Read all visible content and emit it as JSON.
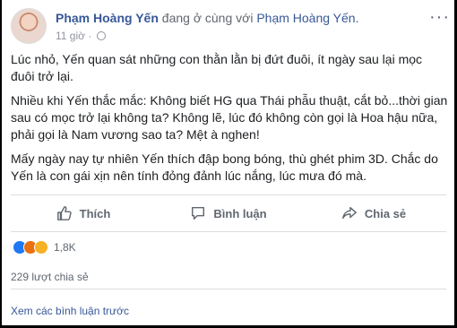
{
  "post": {
    "author": "Phạm Hoàng Yến",
    "with_text": "đang ở cùng với",
    "tagged": "Phạm Hoàng Yến.",
    "time": "11 giờ ·",
    "more": "···",
    "paragraphs": [
      "Lúc nhỏ, Yến quan sát những con thằn lằn bị đứt đuôi, ít ngày sau lại mọc đuôi trở lại.",
      "Nhiều khi Yến thắc mắc: Không biết HG qua Thái phẫu thuật, cắt bỏ...thời gian sau có mọc trở lại không ta? Không lẽ, lúc đó không còn gọi là Hoa hậu nữa, phải gọi là Nam vương sao ta? Mệt à nghen!",
      "Mấy ngày nay tự nhiên Yến thích đập bong bóng, thù ghét phim 3D. Chắc do Yến là con gái xịn nên tính đỏng đảnh lúc nắng, lúc mưa đó mà."
    ]
  },
  "actions": {
    "like": "Thích",
    "comment": "Bình luận",
    "share": "Chia sẻ"
  },
  "reactions": {
    "icons": [
      "like-icon",
      "angry-icon",
      "haha-icon"
    ],
    "count": "1,8K"
  },
  "shares": "229 lượt chia sẻ",
  "comments_link": "Xem các bình luận trước"
}
